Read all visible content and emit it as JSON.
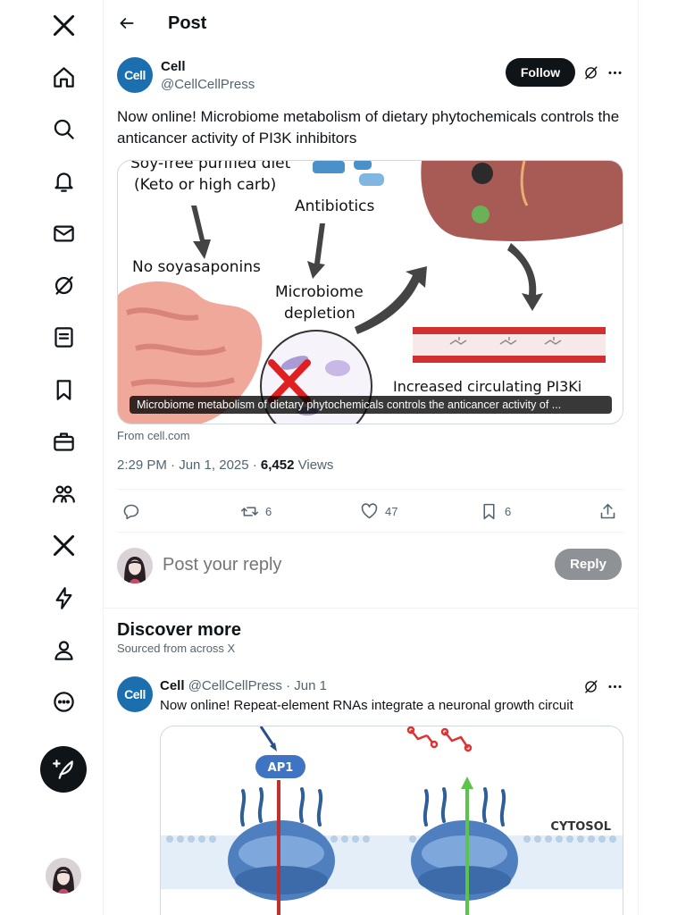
{
  "nav": {
    "items": [
      {
        "icon": "x-logo-icon"
      },
      {
        "icon": "home-icon"
      },
      {
        "icon": "search-icon"
      },
      {
        "icon": "bell-icon"
      },
      {
        "icon": "mail-icon"
      },
      {
        "icon": "grok-icon"
      },
      {
        "icon": "lists-icon"
      },
      {
        "icon": "bookmark-icon"
      },
      {
        "icon": "jobs-icon"
      },
      {
        "icon": "communities-icon"
      },
      {
        "icon": "premium-icon"
      },
      {
        "icon": "verified-orgs-icon"
      },
      {
        "icon": "profile-icon"
      },
      {
        "icon": "more-icon"
      }
    ],
    "compose_icon": "compose-icon"
  },
  "header": {
    "title": "Post"
  },
  "post": {
    "avatar_text": "Cell",
    "author_name": "Cell",
    "author_handle": "@CellCellPress",
    "follow_label": "Follow",
    "text": "Now online!  Microbiome metabolism of dietary phytochemicals controls the anticancer activity of PI3K inhibitors",
    "media": {
      "labels": {
        "diet": "Soy-free purified diet",
        "diet2": "(Keto or high carb)",
        "antibiotics": "Antibiotics",
        "no_saponins": "No soyasaponins",
        "microbiome": "Microbiome",
        "depletion": "depletion",
        "pi3k": "Increased circulating PI3Ki"
      },
      "caption": "Microbiome metabolism of dietary phytochemicals controls the anticancer activity of ..."
    },
    "from": "From cell.com",
    "time": "2:29 PM · Jun 1, 2025 · ",
    "views_count": "6,452",
    "views_label": " Views",
    "actions": {
      "reposts": "6",
      "likes": "47",
      "bookmarks": "6"
    }
  },
  "reply": {
    "placeholder": "Post your reply",
    "button": "Reply"
  },
  "discover": {
    "title": "Discover more",
    "subtitle": "Sourced from across X",
    "post": {
      "name": "Cell",
      "handle": "@CellCellPress",
      "dot": " · ",
      "date": "Jun 1",
      "text": "Now online!  Repeat-element RNAs integrate a neuronal growth circuit",
      "media": {
        "ap1": "AP1",
        "cytosol": "CYTOSOL"
      }
    }
  },
  "colors": {
    "text": "#0f1419",
    "secondary": "#536471",
    "border": "#cfd9de",
    "cell_blue": "#1b6fae"
  }
}
